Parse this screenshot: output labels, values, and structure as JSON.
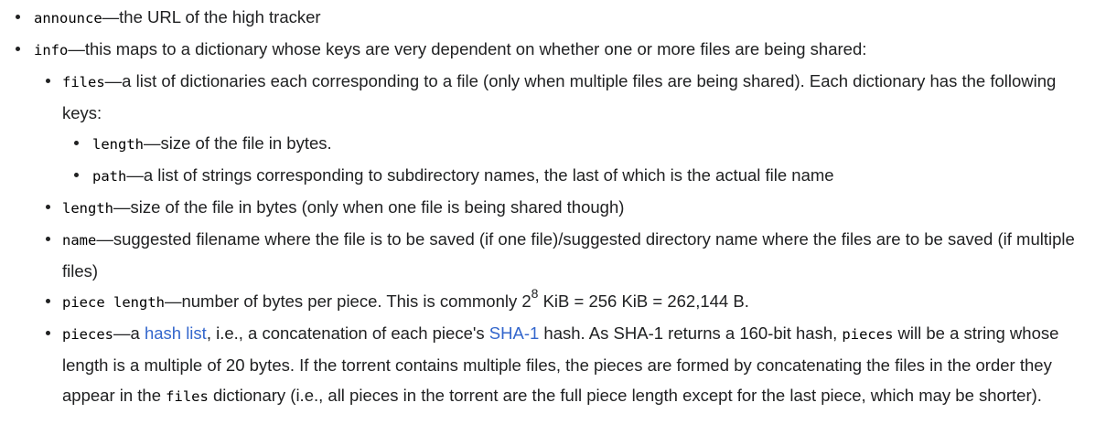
{
  "items": {
    "announce": {
      "key": "announce",
      "text": "—the URL of the high tracker"
    },
    "info": {
      "key": "info",
      "text": "—this maps to a dictionary whose keys are very dependent on whether one or more files are being shared:",
      "files": {
        "key": "files",
        "text": "—a list of dictionaries each corresponding to a file (only when multiple files are being shared). Each dictionary has the following keys:",
        "length": {
          "key": "length",
          "text": "—size of the file in bytes."
        },
        "path": {
          "key": "path",
          "text": "—a list of strings corresponding to subdirectory names, the last of which is the actual file name"
        }
      },
      "length": {
        "key": "length",
        "text": "—size of the file in bytes (only when one file is being shared though)"
      },
      "name": {
        "key": "name",
        "text": "—suggested filename where the file is to be saved (if one file)/suggested directory name where the files are to be saved (if multiple files)"
      },
      "piece_length": {
        "key": "piece length",
        "text_before": "—number of bytes per piece. This is commonly 2",
        "sup": "8",
        "text_after": " KiB = 256 KiB = 262,144 B."
      },
      "pieces": {
        "key": "pieces",
        "t1": "—a ",
        "link1": "hash list",
        "t2": ", i.e., a concatenation of each piece's ",
        "link2": "SHA-1",
        "t3": " hash. As SHA-1 returns a 160-bit hash, ",
        "code1": "pieces",
        "t4": " will be a string whose length is a multiple of 20 bytes. If the torrent contains multiple files, the pieces are formed by concatenating the files in the order they appear in the ",
        "code2": "files",
        "t5": " dictionary (i.e., all pieces in the torrent are the full piece length except for the last piece, which may be shorter)."
      }
    }
  }
}
